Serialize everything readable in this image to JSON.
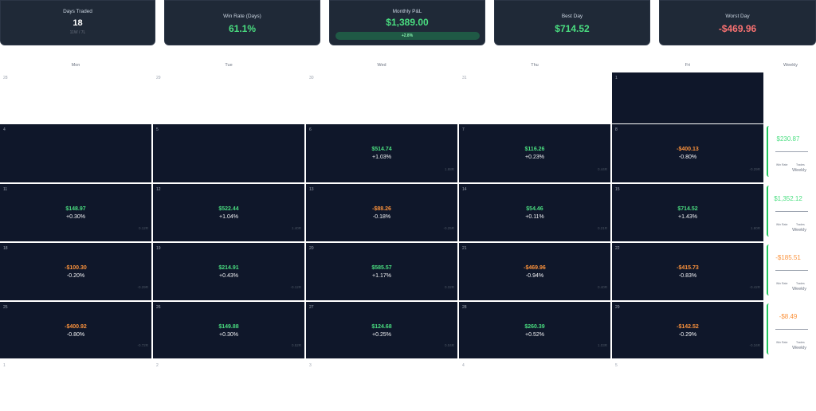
{
  "stats": {
    "days_traded": {
      "label": "Days Traded",
      "value": "18",
      "sub": "11W / 7L"
    },
    "win_rate": {
      "label": "Win Rate (Days)",
      "value": "61.1%"
    },
    "monthly_pnl": {
      "label": "Monthly P&L",
      "value": "$1,389.00",
      "badge": "+2.8%"
    },
    "best_day": {
      "label": "Best Day",
      "value": "$714.52"
    },
    "worst_day": {
      "label": "Worst Day",
      "value": "-$469.96"
    }
  },
  "day_headers": [
    "Mon",
    "Tue",
    "Wed",
    "Thu",
    "Fri",
    "Weekly"
  ],
  "weeks": [
    [
      {
        "day": "28",
        "style": "light"
      },
      {
        "day": "29",
        "style": "light"
      },
      {
        "day": "30",
        "style": "light"
      },
      {
        "day": "31",
        "style": "light"
      },
      {
        "day": "1",
        "style": "dark"
      }
    ],
    [
      {
        "day": "4",
        "style": "dark"
      },
      {
        "day": "5",
        "style": "dark"
      },
      {
        "day": "6",
        "style": "dark",
        "pnl": "$514.74",
        "pct": "+1.03%",
        "vol": "1.88R",
        "sign": "pos"
      },
      {
        "day": "7",
        "style": "dark",
        "pnl": "$116.26",
        "pct": "+0.23%",
        "vol": "0.44R",
        "sign": "pos"
      },
      {
        "day": "8",
        "style": "dark",
        "pnl": "-$400.13",
        "pct": "-0.80%",
        "vol": "-0.29R",
        "sign": "neg"
      }
    ],
    [
      {
        "day": "11",
        "style": "dark",
        "pnl": "$148.97",
        "pct": "+0.30%",
        "vol": "0.12R",
        "sign": "pos"
      },
      {
        "day": "12",
        "style": "dark",
        "pnl": "$522.44",
        "pct": "+1.04%",
        "vol": "1.40R",
        "sign": "pos"
      },
      {
        "day": "13",
        "style": "dark",
        "pnl": "-$88.26",
        "pct": "-0.18%",
        "vol": "-0.25R",
        "sign": "neg"
      },
      {
        "day": "14",
        "style": "dark",
        "pnl": "$54.46",
        "pct": "+0.11%",
        "vol": "0.21R",
        "sign": "pos"
      },
      {
        "day": "15",
        "style": "dark",
        "pnl": "$714.52",
        "pct": "+1.43%",
        "vol": "1.80R",
        "sign": "pos"
      }
    ],
    [
      {
        "day": "18",
        "style": "dark",
        "pnl": "-$100.30",
        "pct": "-0.20%",
        "vol": "-0.29R",
        "sign": "neg"
      },
      {
        "day": "19",
        "style": "dark",
        "pnl": "$214.91",
        "pct": "+0.43%",
        "vol": "-0.12R",
        "sign": "pos"
      },
      {
        "day": "20",
        "style": "dark",
        "pnl": "$585.57",
        "pct": "+1.17%",
        "vol": "0.32R",
        "sign": "pos"
      },
      {
        "day": "21",
        "style": "dark",
        "pnl": "-$469.96",
        "pct": "-0.94%",
        "vol": "0.40R",
        "sign": "neg"
      },
      {
        "day": "22",
        "style": "dark",
        "pnl": "-$415.73",
        "pct": "-0.83%",
        "vol": "-0.42R",
        "sign": "neg"
      }
    ],
    [
      {
        "day": "25",
        "style": "dark",
        "pnl": "-$400.92",
        "pct": "-0.80%",
        "vol": "-0.72R",
        "sign": "neg"
      },
      {
        "day": "26",
        "style": "dark",
        "pnl": "$149.88",
        "pct": "+0.30%",
        "vol": "0.52R",
        "sign": "pos"
      },
      {
        "day": "27",
        "style": "dark",
        "pnl": "$124.68",
        "pct": "+0.25%",
        "vol": "0.04R",
        "sign": "pos"
      },
      {
        "day": "28",
        "style": "dark",
        "pnl": "$260.39",
        "pct": "+0.52%",
        "vol": "1.03R",
        "sign": "pos"
      },
      {
        "day": "29",
        "style": "dark",
        "pnl": "-$142.52",
        "pct": "-0.29%",
        "vol": "-0.34R",
        "sign": "neg"
      }
    ],
    [
      {
        "day": "1",
        "style": "light"
      },
      {
        "day": "2",
        "style": "light"
      },
      {
        "day": "3",
        "style": "light"
      },
      {
        "day": "4",
        "style": "light"
      },
      {
        "day": "5",
        "style": "light"
      }
    ]
  ],
  "weekly": [
    {
      "pnl": "$230.87",
      "sign": "pos",
      "win_rate_label": "Win Rate",
      "trades_label": "Trades",
      "title": "Weekly"
    },
    {
      "pnl": "$1,352.12",
      "sign": "pos",
      "win_rate_label": "Win Rate",
      "trades_label": "Trades",
      "title": "Weekly"
    },
    {
      "pnl": "-$185.51",
      "sign": "neg",
      "win_rate_label": "Win Rate",
      "trades_label": "Trades",
      "title": "Weekly"
    },
    {
      "pnl": "-$8.49",
      "sign": "neg",
      "win_rate_label": "Win Rate",
      "trades_label": "Trades",
      "title": "Weekly"
    }
  ],
  "colors": {
    "positive": "#4ade80",
    "negative": "#fb923c",
    "cell_bg": "#0f172a",
    "card_bg": "#1f2937"
  }
}
